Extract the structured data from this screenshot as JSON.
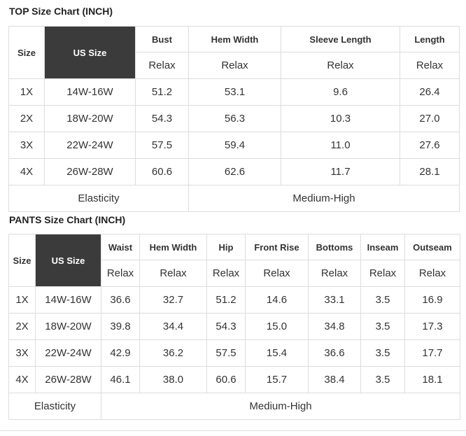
{
  "top": {
    "title": "TOP Size Chart (INCH)",
    "size_header": "Size",
    "us_header": "US Size",
    "columns": [
      "Bust",
      "Hem Width",
      "Sleeve Length",
      "Length"
    ],
    "subheader": "Relax",
    "rows": [
      [
        "1X",
        "14W-16W",
        "51.2",
        "53.1",
        "9.6",
        "26.4"
      ],
      [
        "2X",
        "18W-20W",
        "54.3",
        "56.3",
        "10.3",
        "27.0"
      ],
      [
        "3X",
        "22W-24W",
        "57.5",
        "59.4",
        "11.0",
        "27.6"
      ],
      [
        "4X",
        "26W-28W",
        "60.6",
        "62.6",
        "11.7",
        "28.1"
      ]
    ],
    "elasticity_label": "Elasticity",
    "elasticity_value": "Medium-High"
  },
  "pants": {
    "title": "PANTS Size Chart (INCH)",
    "size_header": "Size",
    "us_header": "US Size",
    "columns": [
      "Waist",
      "Hem Width",
      "Hip",
      "Front Rise",
      "Bottoms",
      "Inseam",
      "Outseam"
    ],
    "subheader": "Relax",
    "rows": [
      [
        "1X",
        "14W-16W",
        "36.6",
        "32.7",
        "51.2",
        "14.6",
        "33.1",
        "3.5",
        "16.9"
      ],
      [
        "2X",
        "18W-20W",
        "39.8",
        "34.4",
        "54.3",
        "15.0",
        "34.8",
        "3.5",
        "17.3"
      ],
      [
        "3X",
        "22W-24W",
        "42.9",
        "36.2",
        "57.5",
        "15.4",
        "36.6",
        "3.5",
        "17.7"
      ],
      [
        "4X",
        "26W-28W",
        "46.1",
        "38.0",
        "60.6",
        "15.7",
        "38.4",
        "3.5",
        "18.1"
      ]
    ],
    "elasticity_label": "Elasticity",
    "elasticity_value": "Medium-High"
  }
}
